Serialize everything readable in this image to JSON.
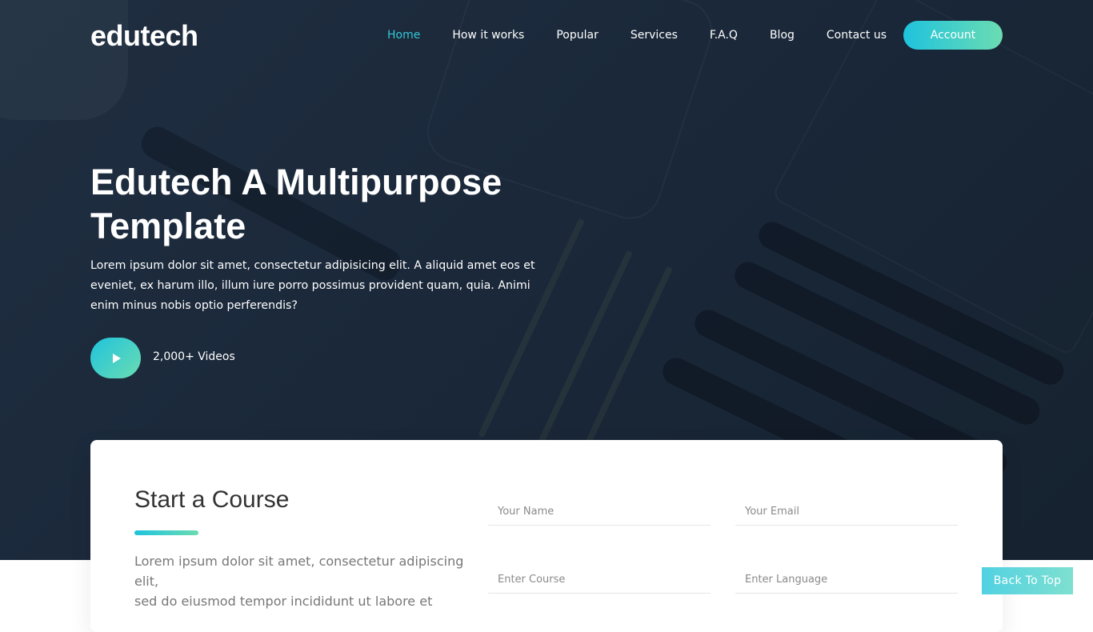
{
  "header": {
    "logo": "edutech",
    "nav": [
      {
        "label": "Home",
        "active": true
      },
      {
        "label": "How it works",
        "active": false
      },
      {
        "label": "Popular",
        "active": false
      },
      {
        "label": "Services",
        "active": false
      },
      {
        "label": "F.A.Q",
        "active": false
      },
      {
        "label": "Blog",
        "active": false
      },
      {
        "label": "Contact us",
        "active": false
      }
    ],
    "account_label": "Account"
  },
  "hero": {
    "title": "Edutech A Multipurpose Template",
    "text": "Lorem ipsum dolor sit amet, consectetur adipisicing elit. A aliquid amet eos et eveniet, ex harum illo, illum iure porro possimus provident quam, quia. Animi enim minus nobis optio perferendis?",
    "play_icon": "play-icon",
    "videos_label": "2,000+ Videos"
  },
  "course_form": {
    "title": "Start a Course",
    "text": "Lorem ipsum dolor sit amet, consectetur adipiscing elit,\nsed do eiusmod tempor incididunt ut labore et",
    "name_placeholder": "Your Name",
    "email_placeholder": "Your Email",
    "course_placeholder": "Enter Course",
    "language_placeholder": "Enter Language"
  },
  "back_to_top_label": "Back To Top",
  "colors": {
    "accent": "#34c7d6",
    "gradient_start": "#1fc3dd",
    "gradient_end": "#6bdcb2",
    "hero_bg": "#1c2a3b"
  }
}
